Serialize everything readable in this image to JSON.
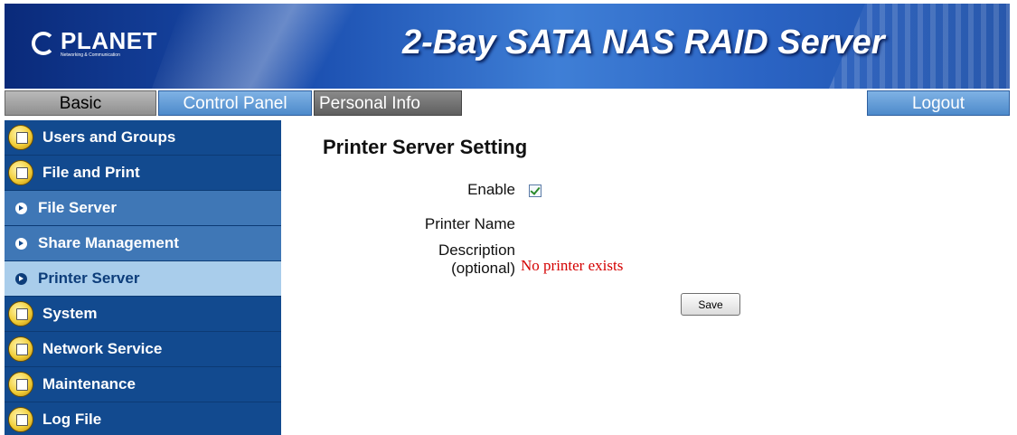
{
  "banner": {
    "logo_text": "PLANET",
    "logo_subtext": "Networking & Communication",
    "title": "2-Bay SATA NAS RAID Server"
  },
  "tabs": {
    "basic": "Basic",
    "control_panel": "Control Panel",
    "personal_info": "Personal Info",
    "logout": "Logout"
  },
  "sidebar": {
    "items": [
      {
        "label": "Users and Groups",
        "kind": "category",
        "icon": "folder-icon"
      },
      {
        "label": "File and Print",
        "kind": "category",
        "icon": "folder-icon"
      },
      {
        "label": "File Server",
        "kind": "sub",
        "icon": "arrow-icon"
      },
      {
        "label": "Share Management",
        "kind": "sub",
        "icon": "arrow-icon"
      },
      {
        "label": "Printer Server",
        "kind": "sub",
        "icon": "arrow-icon",
        "active": true
      },
      {
        "label": "System",
        "kind": "category",
        "icon": "folder-icon"
      },
      {
        "label": "Network Service",
        "kind": "category",
        "icon": "folder-icon"
      },
      {
        "label": "Maintenance",
        "kind": "category",
        "icon": "folder-icon"
      },
      {
        "label": "Log File",
        "kind": "category",
        "icon": "folder-icon"
      }
    ]
  },
  "main": {
    "title": "Printer Server Setting",
    "enable_label": "Enable",
    "enable_checked": true,
    "printer_name_label": "Printer Name",
    "description_label_1": "Description",
    "description_label_2": "(optional)",
    "status_message": "No printer exists",
    "save_label": "Save"
  },
  "colors": {
    "sidebar_bg": "#124a8f",
    "active_item_bg": "#a9cdeb",
    "status_text": "#d40000"
  }
}
